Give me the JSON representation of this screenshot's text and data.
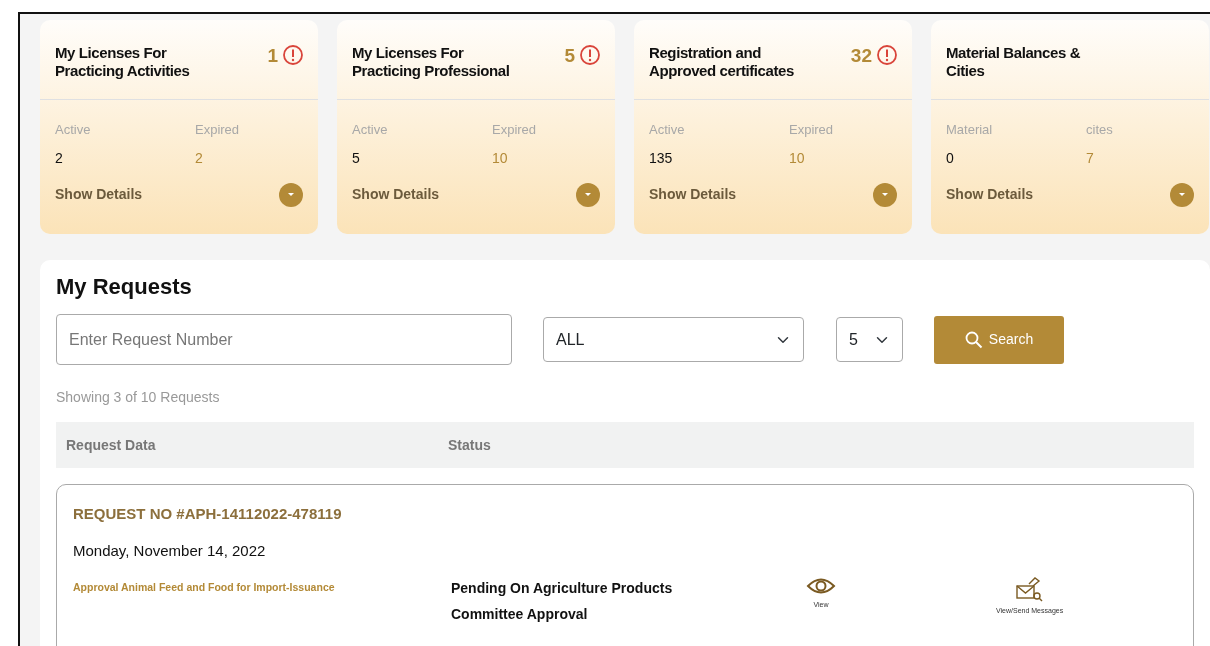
{
  "summary_cards": [
    {
      "title": "My Licenses For Practicing Activities",
      "count": "1",
      "stats": [
        {
          "label": "Active",
          "value": "2"
        },
        {
          "label": "Expired",
          "value": "2"
        }
      ],
      "details_link": "Show Details"
    },
    {
      "title": "My Licenses For Practicing Professional",
      "count": "5",
      "stats": [
        {
          "label": "Active",
          "value": "5"
        },
        {
          "label": "Expired",
          "value": "10"
        }
      ],
      "details_link": "Show Details"
    },
    {
      "title": "Registration and Approved certificates",
      "count": "32",
      "stats": [
        {
          "label": "Active",
          "value": "135"
        },
        {
          "label": "Expired",
          "value": "10"
        }
      ],
      "details_link": "Show Details"
    },
    {
      "title": "Material Balances & Cities",
      "stats": [
        {
          "label": "Material",
          "value": "0"
        },
        {
          "label": "cites",
          "value": "7"
        }
      ],
      "details_link": "Show Details"
    }
  ],
  "requests": {
    "title": "My Requests",
    "search_field": {
      "placeholder": "Enter Request Number"
    },
    "status_filter": "ALL",
    "page_size": "5",
    "search_button": "Search",
    "summary": "Showing 3 of 10 Requests",
    "columns": [
      "Request Data",
      "Status"
    ],
    "rows": [
      {
        "number": "REQUEST NO #APH-14112022-478119",
        "date": "Monday, November 14, 2022",
        "service": "Approval Animal Feed and Food for Import-Issuance",
        "status": "Pending On Agriculture Products Committee Approval",
        "actions": [
          {
            "kind": "view",
            "label": "View"
          },
          {
            "kind": "messages",
            "label": "View/Send Messages"
          }
        ]
      }
    ]
  }
}
